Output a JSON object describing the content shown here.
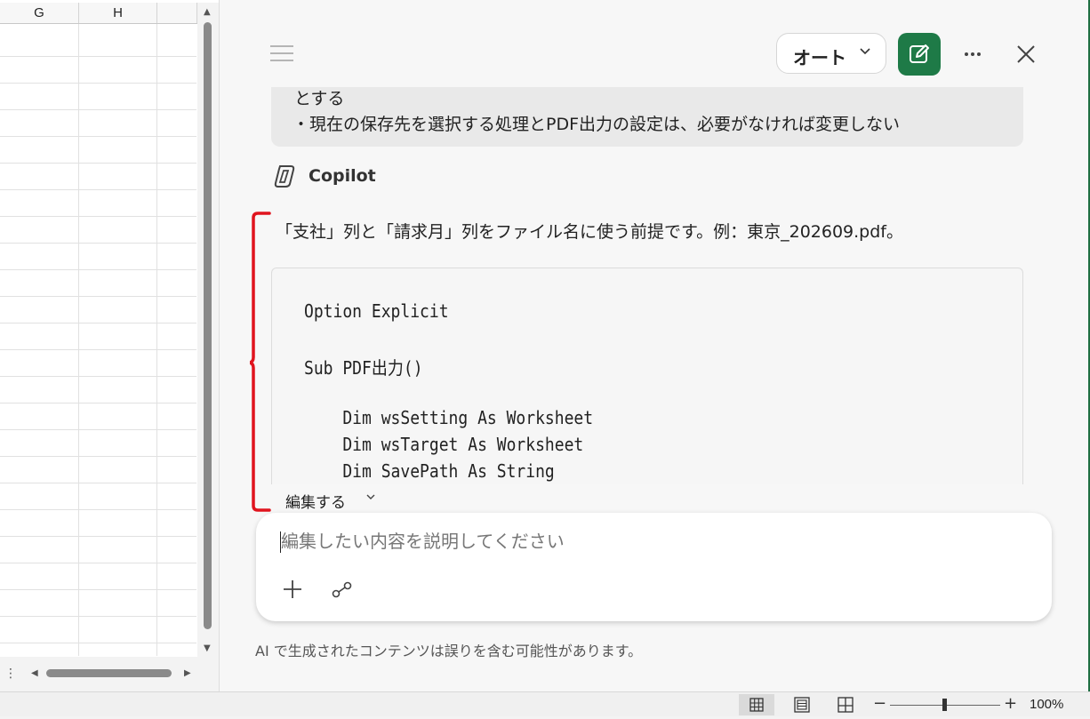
{
  "sheet": {
    "columns": [
      "G",
      "H"
    ]
  },
  "copilot": {
    "mode_label": "オート",
    "user_message": {
      "line1": "とする",
      "line2": "・現在の保存先を選択する処理とPDF出力の設定は、必要がなければ変更しない"
    },
    "assistant_name": "Copilot",
    "response_text": "「支社」列と「請求月」列をファイル名に使う前提です。例：東京_202609.pdf。",
    "code_lines": [
      "Option Explicit",
      "",
      "Sub PDF出力()",
      "",
      "    Dim wsSetting As Worksheet",
      "    Dim wsTarget As Worksheet",
      "    Dim SavePath As String"
    ],
    "edit_label": "編集する",
    "input_placeholder": "編集したい内容を説明してください",
    "disclaimer": "AI で生成されたコンテンツは誤りを含む可能性があります。"
  },
  "statusbar": {
    "zoom_level": "100%",
    "zoom_minus": "−",
    "zoom_plus": "+"
  },
  "colors": {
    "accent": "#1e7a47",
    "annotation": "#e0141e"
  }
}
